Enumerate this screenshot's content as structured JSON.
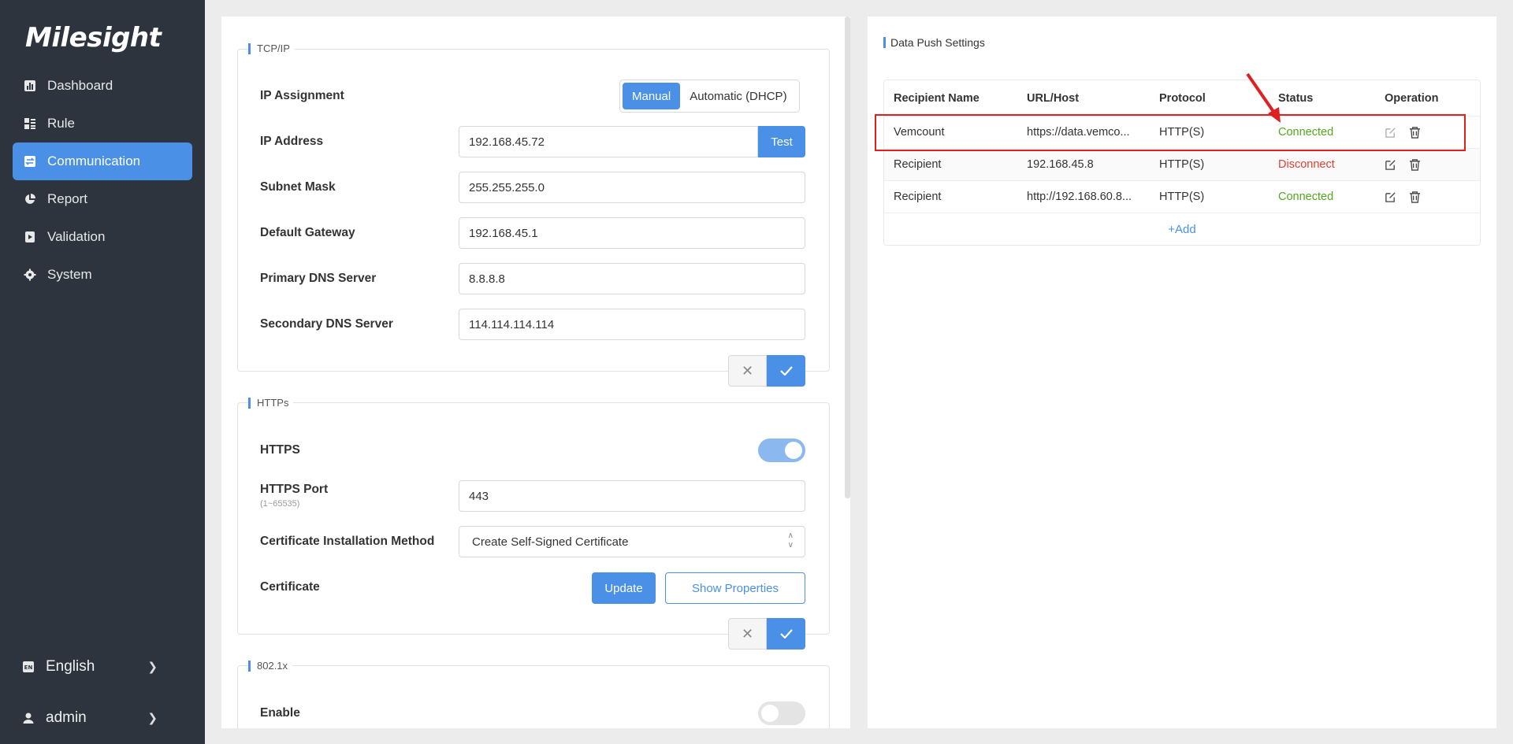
{
  "brand": {
    "logo": "Milesight",
    "accent": "#4a90e6"
  },
  "sidebar": {
    "items": [
      {
        "label": "Dashboard",
        "icon": "bar-chart-icon",
        "active": false
      },
      {
        "label": "Rule",
        "icon": "list-icon",
        "active": false
      },
      {
        "label": "Communication",
        "icon": "swap-icon",
        "active": true
      },
      {
        "label": "Report",
        "icon": "pie-chart-icon",
        "active": false
      },
      {
        "label": "Validation",
        "icon": "validation-icon",
        "active": false
      },
      {
        "label": "System",
        "icon": "gear-icon",
        "active": false
      }
    ],
    "language": {
      "label": "English",
      "badge": "EN"
    },
    "user": {
      "label": "admin"
    }
  },
  "tcpip": {
    "legend": "TCP/IP",
    "ip_assignment_label": "IP Assignment",
    "ip_assignment_options": [
      "Manual",
      "Automatic (DHCP)"
    ],
    "ip_assignment_selected": "Manual",
    "ip_address_label": "IP Address",
    "ip_address_value": "192.168.45.72",
    "test_label": "Test",
    "subnet_label": "Subnet Mask",
    "subnet_value": "255.255.255.0",
    "gateway_label": "Default Gateway",
    "gateway_value": "192.168.45.1",
    "dns1_label": "Primary DNS Server",
    "dns1_value": "8.8.8.8",
    "dns2_label": "Secondary DNS Server",
    "dns2_value": "114.114.114.114"
  },
  "https": {
    "legend": "HTTPs",
    "https_label": "HTTPS",
    "https_enabled": true,
    "port_label": "HTTPS Port",
    "port_hint": "(1~65535)",
    "port_value": "443",
    "cert_method_label": "Certificate Installation Method",
    "cert_method_value": "Create Self-Signed Certificate",
    "cert_label": "Certificate",
    "update_label": "Update",
    "show_props_label": "Show Properties"
  },
  "dot1x": {
    "legend": "802.1x",
    "enable_label": "Enable",
    "enabled": false
  },
  "data_push": {
    "title": "Data Push Settings",
    "columns": [
      "Recipient Name",
      "URL/Host",
      "Protocol",
      "Status",
      "Operation"
    ],
    "rows": [
      {
        "name": "Vemcount",
        "url": "https://data.vemco...",
        "protocol": "HTTP(S)",
        "status": "Connected",
        "ok": true
      },
      {
        "name": "Recipient",
        "url": "192.168.45.8",
        "protocol": "HTTP(S)",
        "status": "Disconnect",
        "ok": false
      },
      {
        "name": "Recipient",
        "url": "http://192.168.60.8...",
        "protocol": "HTTP(S)",
        "status": "Connected",
        "ok": true
      }
    ],
    "add_label": "+Add"
  }
}
